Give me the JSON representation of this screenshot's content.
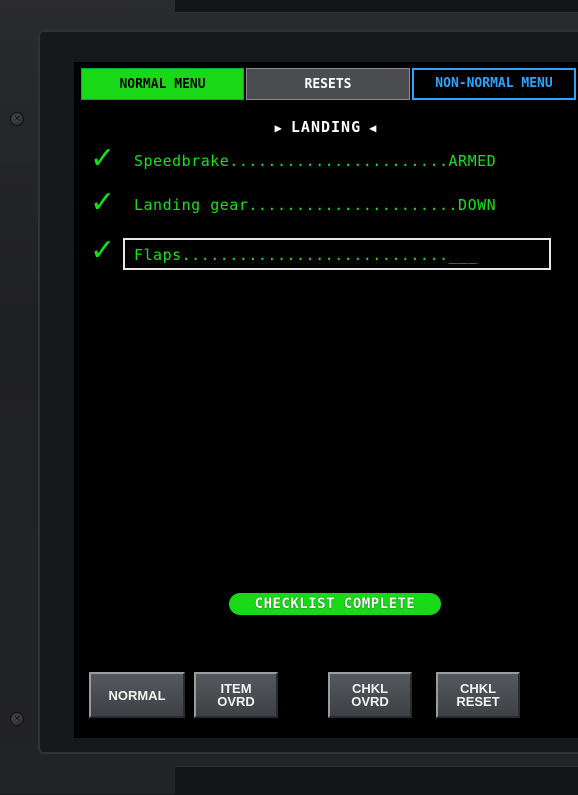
{
  "tabs": {
    "normal_menu": "NORMAL MENU",
    "resets": "RESETS",
    "non_normal_menu": "NON-NORMAL MENU"
  },
  "checklist": {
    "title": "LANDING",
    "items": [
      {
        "text": "Speedbrake.......................ARMED",
        "checked": true
      },
      {
        "text": "Landing gear......................DOWN",
        "checked": true
      },
      {
        "text": "Flaps............................___",
        "checked": true
      }
    ],
    "status": "CHECKLIST COMPLETE"
  },
  "buttons": {
    "normal": "NORMAL",
    "item_ovrd": [
      "ITEM",
      "OVRD"
    ],
    "chkl_ovrd": [
      "CHKL",
      "OVRD"
    ],
    "chkl_reset": [
      "CHKL",
      "RESET"
    ]
  },
  "icons": {
    "check": "check-icon",
    "left_arrow": "triangle-left-icon",
    "right_arrow": "triangle-right-icon",
    "screw": "screw-icon"
  },
  "colors": {
    "green": "#18d818",
    "cyan": "#2aa4ff",
    "white": "#ffffff",
    "screen": "#000000"
  }
}
